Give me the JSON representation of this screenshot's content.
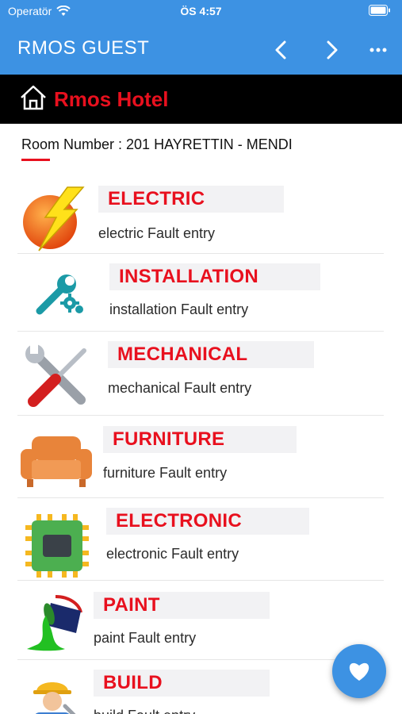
{
  "status_bar": {
    "carrier": "Operatör",
    "time": "ÖS 4:57"
  },
  "nav": {
    "title": "RMOS GUEST",
    "back_icon": "chevron-left-icon",
    "forward_icon": "chevron-right-icon",
    "more_icon": "more-icon"
  },
  "hotel": {
    "name": "Rmos Hotel"
  },
  "room": {
    "text": "Room Number : 201 HAYRETTIN - MENDI"
  },
  "colors": {
    "accent": "#3d92e3",
    "brand_red": "#e8101e",
    "bar_black": "#000000"
  },
  "categories": [
    {
      "label": "ELECTRIC",
      "subtitle": "electric Fault entry",
      "icon": "lightning-icon"
    },
    {
      "label": "INSTALLATION",
      "subtitle": "installation Fault entry",
      "icon": "wrench-gears-icon"
    },
    {
      "label": "MECHANICAL",
      "subtitle": "mechanical Fault entry",
      "icon": "wrench-screwdriver-icon"
    },
    {
      "label": "FURNITURE",
      "subtitle": "furniture Fault entry",
      "icon": "sofa-icon"
    },
    {
      "label": "ELECTRONIC",
      "subtitle": "electronic Fault entry",
      "icon": "chip-icon"
    },
    {
      "label": "PAINT",
      "subtitle": "paint Fault entry",
      "icon": "paint-bucket-icon"
    },
    {
      "label": "BUILD",
      "subtitle": "build Fault entry",
      "icon": "worker-icon"
    }
  ],
  "fab": {
    "icon": "heart-icon"
  }
}
